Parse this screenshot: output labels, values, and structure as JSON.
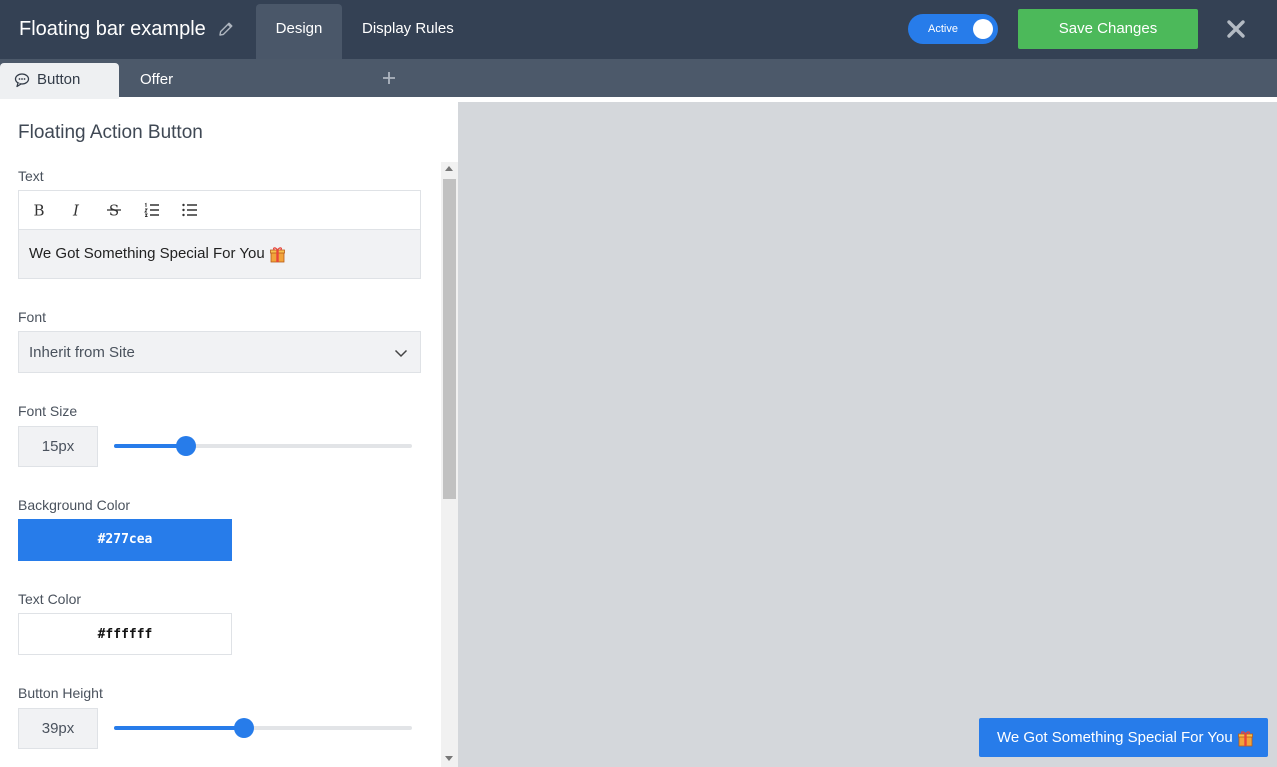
{
  "header": {
    "title": "Floating bar example",
    "tabs": [
      {
        "label": "Design",
        "active": true
      },
      {
        "label": "Display Rules",
        "active": false
      }
    ],
    "toggle_label": "Active",
    "toggle_on": true,
    "save_label": "Save Changes"
  },
  "subtabs": {
    "items": [
      {
        "label": "Button",
        "icon": "comment-icon",
        "active": true
      },
      {
        "label": "Offer",
        "active": false
      }
    ],
    "add_icon": "plus-icon"
  },
  "panel": {
    "title": "Floating Action Button",
    "text_label": "Text",
    "text_value": "We Got Something Special For You",
    "text_emoji": "gift-icon",
    "toolbar": [
      "bold-icon",
      "italic-icon",
      "strikethrough-icon",
      "ordered-list-icon",
      "bullet-list-icon"
    ],
    "font_label": "Font",
    "font_value": "Inherit from Site",
    "font_size_label": "Font Size",
    "font_size_value": "15px",
    "font_size_slider_fraction": 0.24,
    "bg_color_label": "Background Color",
    "bg_color_value": "#277cea",
    "text_color_label": "Text Color",
    "text_color_value": "#ffffff",
    "button_height_label": "Button Height",
    "button_height_value": "39px",
    "button_height_slider_fraction": 0.435
  },
  "preview": {
    "button_text": "We Got Something Special For You",
    "button_color": "#277cea"
  },
  "colors": {
    "topbar": "#344154",
    "accent": "#277cea",
    "save": "#4cb95a"
  }
}
